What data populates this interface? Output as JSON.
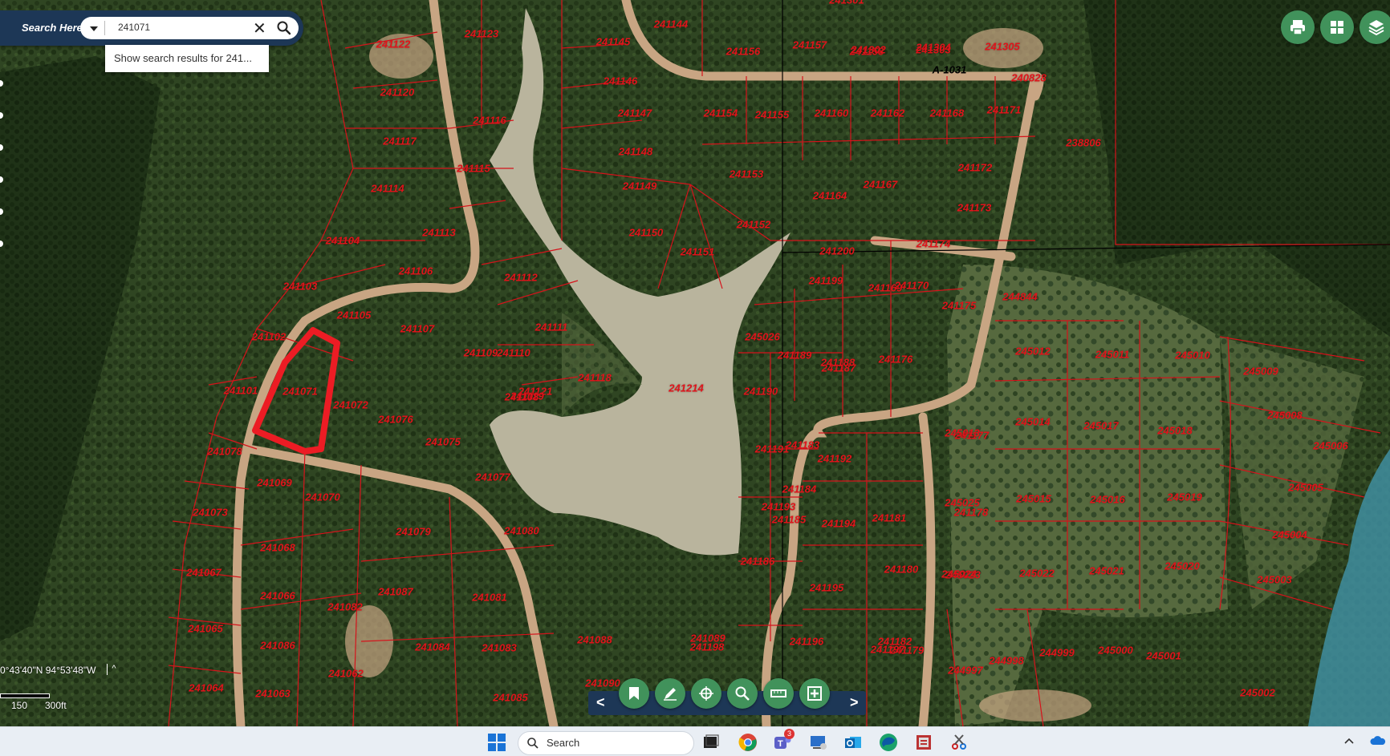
{
  "search": {
    "label": "Search Here:",
    "value": "241071",
    "suggestion": "Show search results for 241..."
  },
  "toolbar_top": {
    "icons": [
      "print-icon",
      "grid-icon",
      "layers-icon"
    ]
  },
  "coords": {
    "text": "0°43'40\"N 94°53'48\"W",
    "caret": "^"
  },
  "scale": {
    "labels": [
      "150",
      "300ft"
    ]
  },
  "bottom_tools": {
    "icons": [
      "bookmark-icon",
      "draw-icon",
      "identify-icon",
      "zoom-select-icon",
      "measure-icon",
      "add-data-icon"
    ],
    "prev": "<",
    "next": ">"
  },
  "map": {
    "abstract": "A-1031",
    "selected_parcel": "241071",
    "parcels": [
      "241122",
      "241123",
      "241120",
      "241117",
      "241116",
      "241114",
      "241115",
      "241104",
      "241113",
      "241103",
      "241105",
      "241106",
      "241102",
      "241107",
      "241101",
      "241071",
      "241072",
      "241076",
      "241075",
      "241077",
      "241078",
      "241069",
      "241070",
      "241073",
      "241068",
      "241079",
      "241067",
      "241080",
      "241066",
      "241065",
      "241082",
      "241087",
      "241086",
      "241081",
      "241083",
      "241064",
      "241063",
      "241062",
      "241084",
      "241085",
      "241088",
      "241089",
      "241090",
      "241121",
      "241118",
      "241119",
      "241112",
      "241111",
      "241109",
      "241108",
      "241110",
      "241214",
      "241144",
      "241145",
      "241146",
      "241147",
      "241148",
      "241149",
      "241150",
      "241151",
      "241152",
      "241153",
      "241154",
      "241155",
      "241156",
      "241157",
      "241158",
      "241160",
      "241162",
      "241164",
      "241167",
      "241168",
      "241169",
      "241170",
      "241171",
      "241172",
      "241173",
      "241174",
      "241175",
      "241176",
      "241177",
      "241178",
      "241179",
      "241180",
      "241181",
      "241182",
      "241183",
      "241184",
      "241185",
      "241186",
      "241187",
      "241188",
      "241189",
      "241190",
      "241191",
      "241192",
      "241193",
      "241194",
      "241195",
      "241196",
      "241197",
      "241198",
      "241199",
      "241200",
      "241301",
      "241302",
      "241303",
      "241304",
      "241305",
      "240828",
      "238806",
      "244844",
      "244997",
      "244998",
      "244999",
      "245000",
      "245001",
      "245002",
      "245003",
      "245004",
      "245005",
      "245006",
      "245008",
      "245009",
      "245010",
      "245011",
      "245012",
      "245013",
      "245014",
      "245015",
      "245016",
      "245017",
      "245018",
      "245019",
      "245020",
      "245021",
      "245022",
      "245023",
      "245024",
      "245025",
      "245026"
    ]
  },
  "taskbar": {
    "search_label": "Search",
    "teams_badge": "3"
  }
}
